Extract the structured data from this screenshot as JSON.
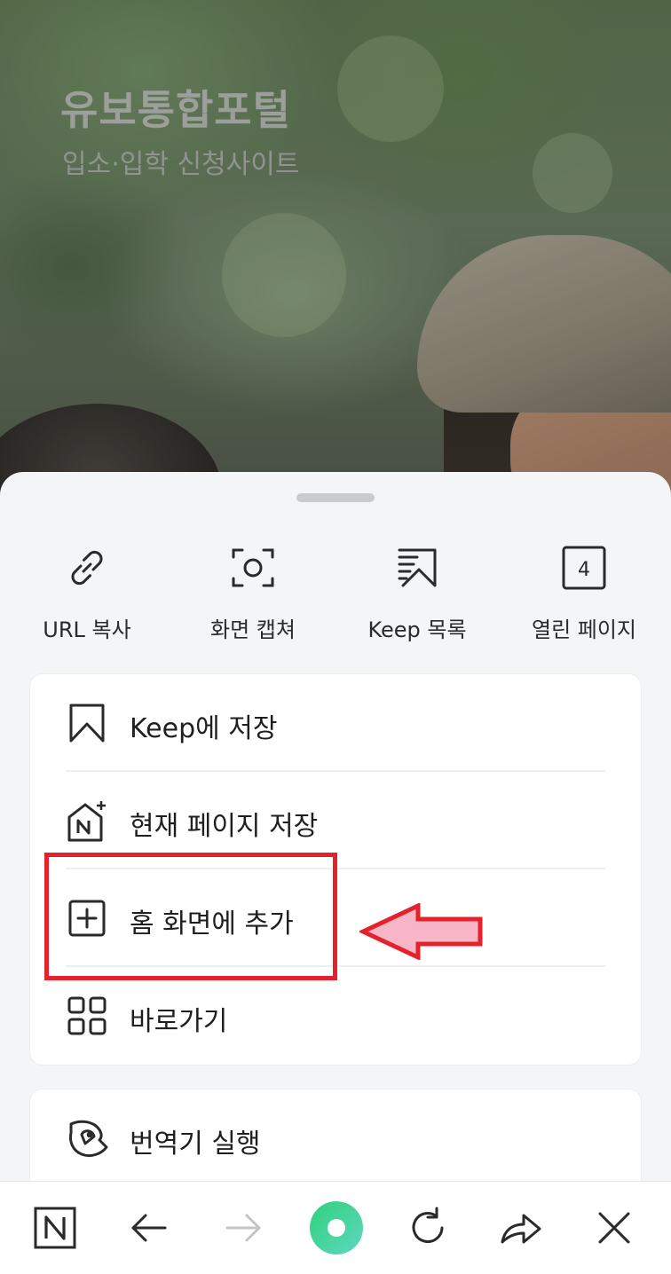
{
  "background_page": {
    "title": "유보통합포털",
    "subtitle": "입소·입학 신청사이트"
  },
  "quick_actions": [
    {
      "label": "URL 복사",
      "icon": "link-icon"
    },
    {
      "label": "화면 캡쳐",
      "icon": "screen-capture-icon"
    },
    {
      "label": "Keep 목록",
      "icon": "keep-list-icon"
    },
    {
      "label": "열린 페이지",
      "icon": "open-pages-icon",
      "count": "4"
    }
  ],
  "menu": {
    "items": [
      {
        "label": "Keep에 저장",
        "icon": "bookmark-icon"
      },
      {
        "label": "현재 페이지 저장",
        "icon": "save-page-icon"
      },
      {
        "label": "홈 화면에 추가",
        "icon": "add-home-icon"
      },
      {
        "label": "바로가기",
        "icon": "shortcut-grid-icon"
      }
    ],
    "secondary_items": [
      {
        "label": "번역기 실행",
        "icon": "translator-icon"
      }
    ]
  },
  "toolbar": {
    "buttons": [
      "naver-home-icon",
      "back-icon",
      "forward-icon",
      "green-dot-icon",
      "reload-icon",
      "share-icon",
      "close-icon"
    ]
  },
  "colors": {
    "annotation_red": "#e5222b",
    "arrow_fill": "#f7b6c8",
    "green_dot": "#3cd07a"
  }
}
